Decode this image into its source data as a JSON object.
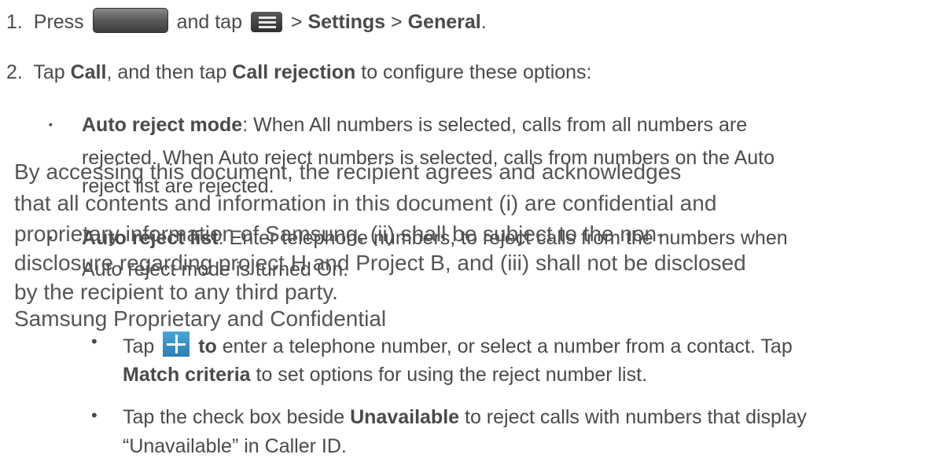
{
  "step1": {
    "number": "1.",
    "press": "Press",
    "and_tap": "and tap",
    "sep1": ">",
    "settings": "Settings",
    "sep2": ">",
    "general": "General",
    "end": ".",
    "icons": [
      "home-key-icon",
      "menu-key-icon"
    ]
  },
  "step2": {
    "number": "2.",
    "tap": "Tap",
    "call": "Call",
    "mid": ", and then tap",
    "call_rejection": "Call rejection",
    "rest": "to configure these options:"
  },
  "auto_reject_mode": {
    "bullet": "▪",
    "term": "Auto reject mode",
    "line1": ": When All numbers is selected, calls from all numbers are",
    "line2": "rejected. When Auto reject numbers is selected, calls from numbers on the Auto",
    "line3": "reject list are rejected."
  },
  "auto_reject_list": {
    "bullet": "▪",
    "term": "Auto reject list",
    "line1": ": Enter telephone numbers, to reject calls from the numbers when",
    "line2": "Auto reject mode is turned On."
  },
  "sub_add": {
    "bullet": "•",
    "tap": "Tap",
    "to": "to",
    "rest": "enter a telephone number, or select a number from a contact. Tap",
    "match_criteria": "Match criteria",
    "line2_rest": "to set options for using the reject number list.",
    "icon": "add-icon"
  },
  "sub_unavailable": {
    "bullet": "•",
    "line1_a": "Tap the check box beside",
    "unavailable": "Unavailable",
    "line1_b": "to reject calls with numbers that display",
    "line2": "“Unavailable” in Caller ID."
  },
  "watermark": {
    "line1": "By accessing this document, the recipient agrees and acknowledges",
    "line2": "that all contents and information in this document (i) are confidential and",
    "line3": "proprietary information of Samsung, (ii) shall be subject to the non-",
    "line4": "disclosure regarding project H and Project B, and (iii) shall not be disclosed",
    "line5": "by the recipient to any third party.",
    "line6": "Samsung Proprietary and Confidential"
  }
}
